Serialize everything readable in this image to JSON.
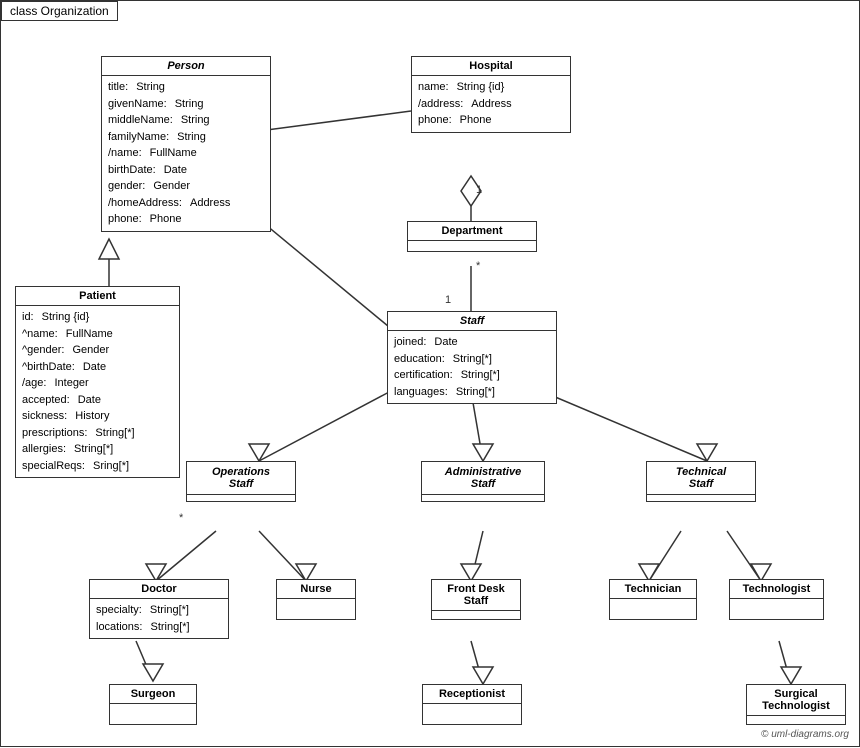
{
  "title": "class Organization",
  "copyright": "© uml-diagrams.org",
  "classes": {
    "person": {
      "name": "Person",
      "italic": true,
      "attributes": [
        {
          "name": "title:",
          "type": "String"
        },
        {
          "name": "givenName:",
          "type": "String"
        },
        {
          "name": "middleName:",
          "type": "String"
        },
        {
          "name": "familyName:",
          "type": "String"
        },
        {
          "name": "/name:",
          "type": "FullName"
        },
        {
          "name": "birthDate:",
          "type": "Date"
        },
        {
          "name": "gender:",
          "type": "Gender"
        },
        {
          "name": "/homeAddress:",
          "type": "Address"
        },
        {
          "name": "phone:",
          "type": "Phone"
        }
      ]
    },
    "hospital": {
      "name": "Hospital",
      "italic": false,
      "attributes": [
        {
          "name": "name:",
          "type": "String {id}"
        },
        {
          "name": "/address:",
          "type": "Address"
        },
        {
          "name": "phone:",
          "type": "Phone"
        }
      ]
    },
    "patient": {
      "name": "Patient",
      "italic": false,
      "attributes": [
        {
          "name": "id:",
          "type": "String {id}"
        },
        {
          "name": "^name:",
          "type": "FullName"
        },
        {
          "name": "^gender:",
          "type": "Gender"
        },
        {
          "name": "^birthDate:",
          "type": "Date"
        },
        {
          "name": "/age:",
          "type": "Integer"
        },
        {
          "name": "accepted:",
          "type": "Date"
        },
        {
          "name": "sickness:",
          "type": "History"
        },
        {
          "name": "prescriptions:",
          "type": "String[*]"
        },
        {
          "name": "allergies:",
          "type": "String[*]"
        },
        {
          "name": "specialReqs:",
          "type": "Sring[*]"
        }
      ]
    },
    "department": {
      "name": "Department",
      "italic": false,
      "attributes": []
    },
    "staff": {
      "name": "Staff",
      "italic": true,
      "attributes": [
        {
          "name": "joined:",
          "type": "Date"
        },
        {
          "name": "education:",
          "type": "String[*]"
        },
        {
          "name": "certification:",
          "type": "String[*]"
        },
        {
          "name": "languages:",
          "type": "String[*]"
        }
      ]
    },
    "operations_staff": {
      "name": "Operations\nStaff",
      "italic": true
    },
    "administrative_staff": {
      "name": "Administrative\nStaff",
      "italic": true
    },
    "technical_staff": {
      "name": "Technical\nStaff",
      "italic": true
    },
    "doctor": {
      "name": "Doctor",
      "italic": false,
      "attributes": [
        {
          "name": "specialty:",
          "type": "String[*]"
        },
        {
          "name": "locations:",
          "type": "String[*]"
        }
      ]
    },
    "nurse": {
      "name": "Nurse",
      "italic": false
    },
    "front_desk_staff": {
      "name": "Front Desk\nStaff",
      "italic": false
    },
    "technician": {
      "name": "Technician",
      "italic": false
    },
    "technologist": {
      "name": "Technologist",
      "italic": false
    },
    "surgeon": {
      "name": "Surgeon",
      "italic": false
    },
    "receptionist": {
      "name": "Receptionist",
      "italic": false
    },
    "surgical_technologist": {
      "name": "Surgical\nTechnologist",
      "italic": false
    }
  }
}
